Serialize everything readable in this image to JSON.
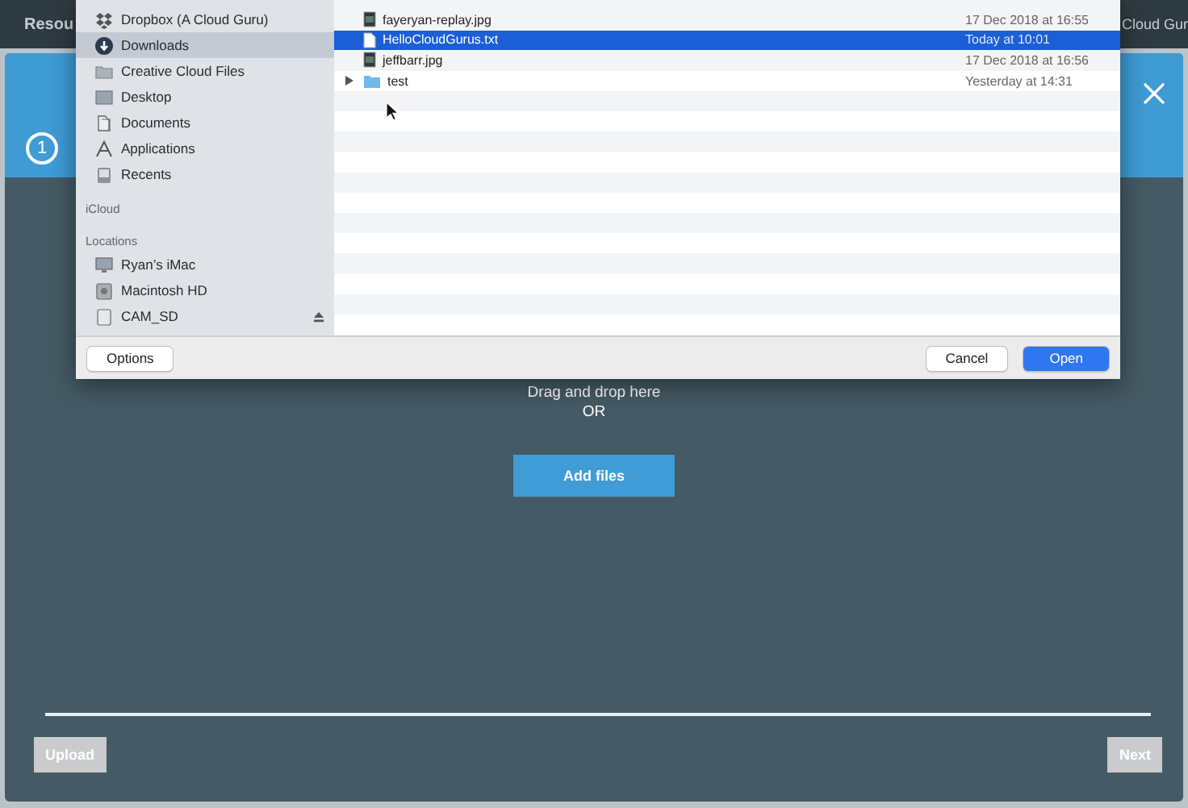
{
  "top_bar": {
    "left_text": "Resou",
    "right_text": "Cloud Gur"
  },
  "modal": {
    "step": {
      "number": "1"
    },
    "drop_text": "Drag and drop here",
    "or_text": "OR",
    "add_button": "Add files",
    "upload_button": {
      "label": "Upload",
      "disabled": true
    },
    "next_button": {
      "label": "Next",
      "disabled": true
    }
  },
  "file_dialog": {
    "sidebar": [
      {
        "items": [
          {
            "label": "Dropbox (A Cloud Guru)",
            "kind": "dropbox",
            "selected": false
          },
          {
            "label": "Downloads",
            "kind": "download",
            "selected": true
          },
          {
            "label": "Creative Cloud Files",
            "kind": "folder",
            "selected": false
          },
          {
            "label": "Desktop",
            "kind": "desktop",
            "selected": false
          },
          {
            "label": "Documents",
            "kind": "documents",
            "selected": false
          },
          {
            "label": "Applications",
            "kind": "applications",
            "selected": false
          },
          {
            "label": "Recents",
            "kind": "recents",
            "selected": false
          }
        ]
      },
      {
        "title": "iCloud"
      },
      {
        "title": "Locations",
        "items": [
          {
            "label": "Ryan’s iMac",
            "kind": "computer",
            "selected": false
          },
          {
            "label": "Macintosh HD",
            "kind": "disk",
            "selected": false
          },
          {
            "label": "CAM_SD",
            "kind": "removable",
            "selected": false
          }
        ]
      }
    ],
    "files": [
      {
        "name": "fayeryan-replay.jpg",
        "date": "17 Dec 2018 at 16:55",
        "kind": "image",
        "selected": false
      },
      {
        "name": "HelloCloudGurus.txt",
        "date": "Today at 10:01",
        "kind": "text",
        "selected": true
      },
      {
        "name": "jeffbarr.jpg",
        "date": "17 Dec 2018 at 16:56",
        "kind": "image",
        "selected": false
      },
      {
        "name": "test",
        "date": "Yesterday at 14:31",
        "kind": "folder",
        "selected": false
      }
    ],
    "options_button": "Options",
    "cancel_button": "Cancel",
    "open_button": "Open"
  }
}
